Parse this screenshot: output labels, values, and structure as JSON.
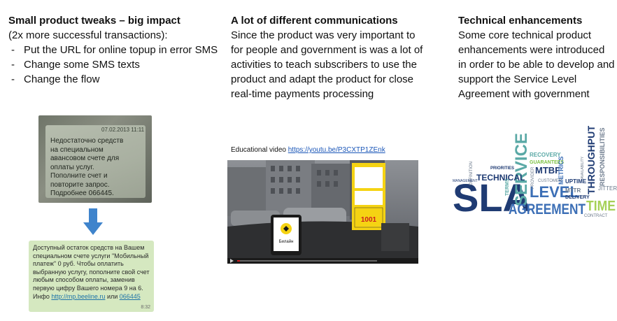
{
  "column1": {
    "heading": "Small product tweaks – big impact",
    "subheading": "(2x more successful transactions):",
    "bullets": [
      "Put the URL for online topup in error SMS",
      "Change some SMS texts",
      "Change the flow"
    ],
    "old_sms": {
      "date": "07.02.2013 11:11",
      "text": "Недостаточно средств\nна специальном\nавансовом счете для\nоплаты услуг.\nПополните счет и\nповторите запрос.\nПодробнее 066445."
    },
    "new_sms": {
      "text": "Доступный остаток средств на Вашем специальном счете услуги \"Мобильный платеж\" 0 руб. Чтобы оплатить выбранную услугу, пополните свой счет любым способом оплаты, заменив первую цифру Вашего номера 9 на 6. Инфо",
      "link1": "http://mp.beeline.ru",
      "or": "или",
      "link2": "066445",
      "time": "8:32"
    }
  },
  "column2": {
    "heading": "A lot of different communications",
    "body": "Since the product was very important to for people and government is was a lot of activities to teach subscribers to use the product and adapt the product for close real-time payments processing",
    "video_caption_label": "Educational video",
    "video_url": "https://youtu.be/P3CXTP1ZEnk",
    "video_brand": "Билайн",
    "video_sign_number": "1001",
    "video_progress": 0.02
  },
  "column3": {
    "heading": "Technical enhancements",
    "body": "Some core technical product enhancements were introduced in order to be able to develop and support the Service Level Agreement with government",
    "word_cloud": {
      "words": [
        "SLA",
        "SERVICE",
        "LEVEL",
        "AGREEMENT",
        "TIME",
        "THROUGHPUT",
        "RESPONSIBILITIES",
        "TECHNICAL",
        "RECOVERY",
        "GUARANTEES",
        "MTBF",
        "METRICS",
        "UPTIME",
        "MTTR",
        "DELIVERY",
        "JITTER",
        "CONTRACT",
        "CUSTOMER",
        "PRIORITIES",
        "TERMS",
        "DEFINITION",
        "MANAGEMENT",
        "PROVIDER",
        "AVAILABILITY"
      ],
      "colors": {
        "navy": "#1f3b73",
        "blue": "#3c6fb6",
        "teal": "#5aa9a6",
        "green": "#7dc242",
        "lime": "#a6d157",
        "gray": "#6d7b8d"
      }
    }
  }
}
